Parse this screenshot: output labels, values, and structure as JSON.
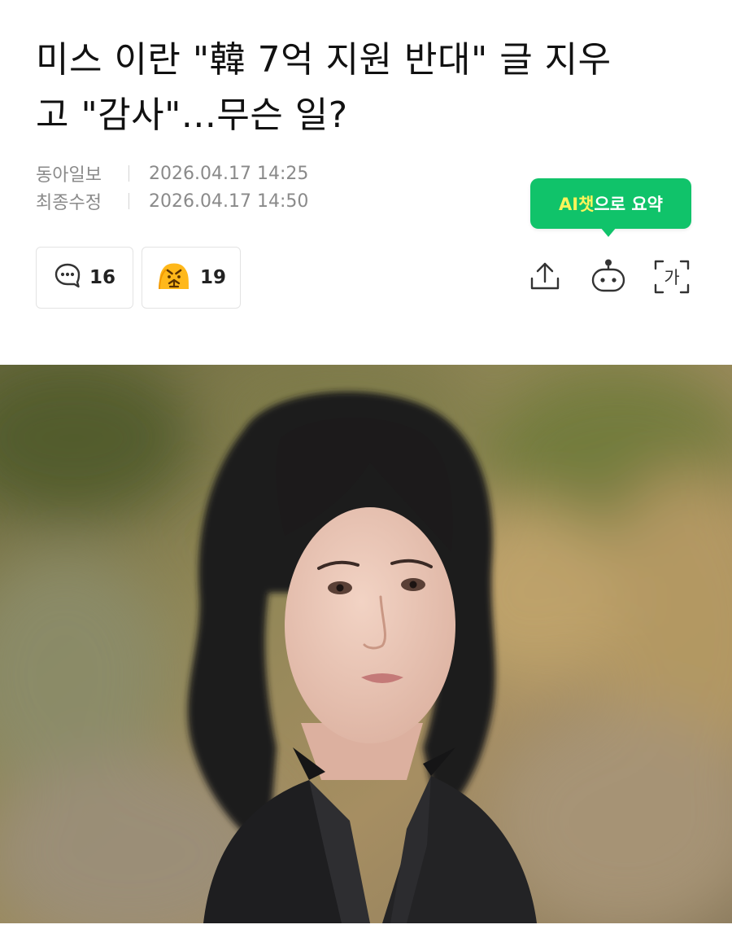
{
  "article": {
    "headline_line1": "미스 이란 \"韓 7억 지원 반대\" 글 지우",
    "headline_line2": "고 \"감사\"...무슨 일?",
    "source": "동아일보",
    "published": "2026.04.17 14:25",
    "modified_label": "최종수정",
    "modified": "2026.04.17 14:50"
  },
  "ai_summary": {
    "label_accent": "AI챗",
    "label_rest": "으로 요약",
    "accent_color": "#fff45a",
    "bg_color": "#10c36a"
  },
  "reactions": {
    "comments_count": "16",
    "reaction_count": "19",
    "comment_icon": "speech-bubble-icon",
    "reaction_icon": "angry-face-icon"
  },
  "toolbar": {
    "share_icon": "share-icon",
    "bot_icon": "robot-icon",
    "font_icon": "font-size-icon",
    "font_glyph": "가"
  }
}
